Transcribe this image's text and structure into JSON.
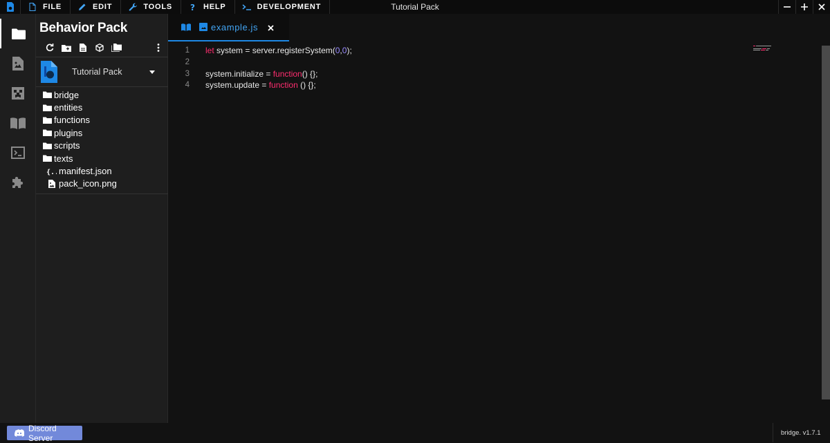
{
  "menubar": {
    "items": [
      {
        "label": "FILE",
        "icon": "file-icon"
      },
      {
        "label": "EDIT",
        "icon": "pencil-icon"
      },
      {
        "label": "TOOLS",
        "icon": "wrench-icon"
      },
      {
        "label": "HELP",
        "icon": "question-icon"
      },
      {
        "label": "DEVELOPMENT",
        "icon": "terminal-prompt-icon"
      }
    ],
    "window_title": "Tutorial Pack",
    "controls": [
      "minimize",
      "maximize",
      "close"
    ]
  },
  "activitybar": {
    "items": [
      {
        "name": "explorer",
        "icon": "folder-icon",
        "active": true
      },
      {
        "name": "resource-pack",
        "icon": "image-file-icon",
        "active": false
      },
      {
        "name": "minecraft",
        "icon": "creeper-icon",
        "active": false
      },
      {
        "name": "docs",
        "icon": "book-icon",
        "active": false
      },
      {
        "name": "console",
        "icon": "console-icon",
        "active": false
      },
      {
        "name": "plugins",
        "icon": "puzzle-icon",
        "active": false
      }
    ]
  },
  "sidebar": {
    "title": "Behavior Pack",
    "toolbar": [
      "refresh-icon",
      "new-folder-icon",
      "new-file-icon",
      "cube-icon",
      "folders-icon",
      "more-vertical-icon"
    ],
    "project": {
      "name": "Tutorial Pack"
    },
    "tree": [
      {
        "type": "folder",
        "label": "bridge"
      },
      {
        "type": "folder",
        "label": "entities"
      },
      {
        "type": "folder",
        "label": "functions"
      },
      {
        "type": "folder",
        "label": "plugins"
      },
      {
        "type": "folder",
        "label": "scripts"
      },
      {
        "type": "folder",
        "label": "texts"
      },
      {
        "type": "json",
        "label": "manifest.json"
      },
      {
        "type": "image",
        "label": "pack_icon.png"
      }
    ]
  },
  "editor": {
    "tab": {
      "label": "example.js"
    },
    "lines": [
      {
        "number": "1",
        "tokens": [
          {
            "t": "let",
            "c": "kw"
          },
          {
            "t": " system = server.registerSystem(",
            "c": "txt"
          },
          {
            "t": "0",
            "c": "num"
          },
          {
            "t": ",",
            "c": "txt"
          },
          {
            "t": "0",
            "c": "num"
          },
          {
            "t": ");",
            "c": "txt"
          }
        ]
      },
      {
        "number": "2",
        "tokens": []
      },
      {
        "number": "3",
        "tokens": [
          {
            "t": "system.initialize = ",
            "c": "txt"
          },
          {
            "t": "function",
            "c": "kw"
          },
          {
            "t": "() {};",
            "c": "txt"
          }
        ]
      },
      {
        "number": "4",
        "tokens": [
          {
            "t": "system.update = ",
            "c": "txt"
          },
          {
            "t": "function",
            "c": "kw"
          },
          {
            "t": " () {};",
            "c": "txt"
          }
        ]
      }
    ]
  },
  "footer": {
    "discord_label": "Discord Server",
    "version": "bridge. v1.7.1"
  },
  "colors": {
    "accent": "#1e88e5",
    "keyword": "#ff2d6f",
    "number": "#9a8cff",
    "discord": "#7289da"
  }
}
